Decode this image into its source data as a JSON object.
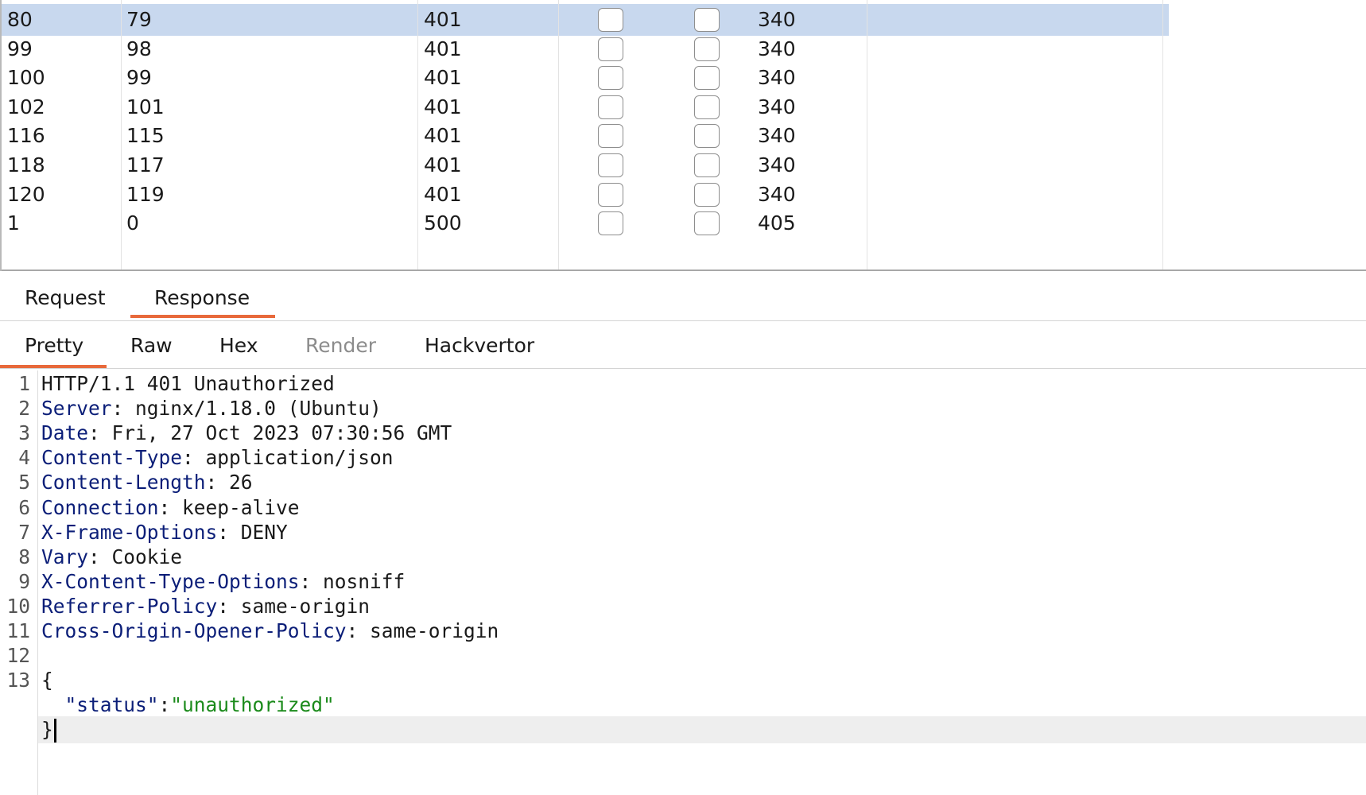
{
  "results": {
    "rows": [
      {
        "request": "80",
        "payload": "79",
        "status": "401",
        "length": "340",
        "selected": true
      },
      {
        "request": "99",
        "payload": "98",
        "status": "401",
        "length": "340"
      },
      {
        "request": "100",
        "payload": "99",
        "status": "401",
        "length": "340"
      },
      {
        "request": "102",
        "payload": "101",
        "status": "401",
        "length": "340"
      },
      {
        "request": "116",
        "payload": "115",
        "status": "401",
        "length": "340"
      },
      {
        "request": "118",
        "payload": "117",
        "status": "401",
        "length": "340"
      },
      {
        "request": "120",
        "payload": "119",
        "status": "401",
        "length": "340"
      },
      {
        "request": "1",
        "payload": "0",
        "status": "500",
        "length": "405"
      }
    ]
  },
  "tabs": {
    "request_label": "Request",
    "response_label": "Response",
    "active": "Response"
  },
  "subtabs": {
    "pretty": "Pretty",
    "raw": "Raw",
    "hex": "Hex",
    "render": "Render",
    "hackvertor": "Hackvertor",
    "active": "Pretty"
  },
  "response": {
    "status_line": "HTTP/1.1 401 Unauthorized",
    "headers": [
      {
        "name": "Server",
        "value": "nginx/1.18.0 (Ubuntu)"
      },
      {
        "name": "Date",
        "value": "Fri, 27 Oct 2023 07:30:56 GMT"
      },
      {
        "name": "Content-Type",
        "value": "application/json"
      },
      {
        "name": "Content-Length",
        "value": "26"
      },
      {
        "name": "Connection",
        "value": "keep-alive"
      },
      {
        "name": "X-Frame-Options",
        "value": "DENY"
      },
      {
        "name": "Vary",
        "value": "Cookie"
      },
      {
        "name": "X-Content-Type-Options",
        "value": "nosniff"
      },
      {
        "name": "Referrer-Policy",
        "value": "same-origin"
      },
      {
        "name": "Cross-Origin-Opener-Policy",
        "value": "same-origin"
      }
    ],
    "body_open": "{",
    "body_key": "\"status\"",
    "body_sep": ":",
    "body_value": "\"unauthorized\"",
    "body_close": "}"
  },
  "colors": {
    "accent": "#e8693b",
    "selected_row": "#c8d8ee",
    "header_key": "#0b1e78",
    "json_string": "#1a8a1a"
  }
}
